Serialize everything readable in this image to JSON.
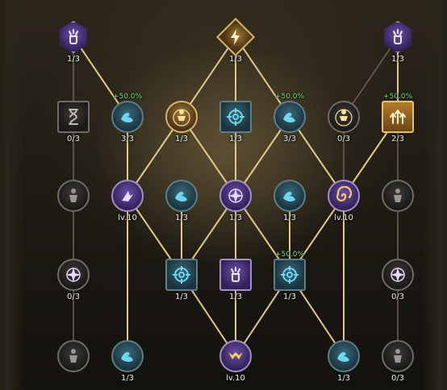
{
  "colors": {
    "line_active": "#e0c98a",
    "line_inactive": "#6a655a",
    "bonus_text": "#7de07a",
    "level_text": "#eeeeee"
  },
  "nodes": [
    {
      "id": "n1",
      "col": 0,
      "row": 0,
      "shape": "hex",
      "color": "purple",
      "icon": "fist-aura-icon",
      "level": "1/3"
    },
    {
      "id": "n2",
      "col": 3,
      "row": 0,
      "shape": "diamond",
      "color": "gold",
      "icon": "lightning-rune-icon",
      "level": "1/3"
    },
    {
      "id": "n3",
      "col": 6,
      "row": 0,
      "shape": "hex",
      "color": "purple",
      "icon": "fist-aura-icon",
      "level": "1/3"
    },
    {
      "id": "n4",
      "col": 0,
      "row": 1,
      "shape": "square",
      "color": "gray",
      "icon": "hourglass-icon",
      "level": "0/3"
    },
    {
      "id": "n5",
      "col": 1,
      "row": 1,
      "shape": "circle",
      "color": "blue",
      "icon": "flexed-arm-icon",
      "level": "3/3",
      "bonus": "+50.0%"
    },
    {
      "id": "n6",
      "col": 2,
      "row": 1,
      "shape": "circle",
      "color": "gold",
      "icon": "body-target-icon",
      "level": "1/3"
    },
    {
      "id": "n7",
      "col": 3,
      "row": 1,
      "shape": "square",
      "color": "blue",
      "icon": "crosshair-icon",
      "level": "1/3"
    },
    {
      "id": "n8",
      "col": 4,
      "row": 1,
      "shape": "circle",
      "color": "blue",
      "icon": "flexed-arm-icon",
      "level": "3/3",
      "bonus": "+50.0%"
    },
    {
      "id": "n9",
      "col": 5,
      "row": 1,
      "shape": "circle",
      "color": "gray",
      "icon": "body-target-icon",
      "level": "0/3"
    },
    {
      "id": "n10",
      "col": 6,
      "row": 1,
      "shape": "square",
      "color": "goldbg",
      "icon": "triple-arrow-up-icon",
      "level": "2/3",
      "bonus": "+50.0%"
    },
    {
      "id": "n11",
      "col": 0,
      "row": 2,
      "shape": "circle",
      "color": "gray",
      "icon": "body-icon",
      "level": ""
    },
    {
      "id": "n12",
      "col": 1,
      "row": 2,
      "shape": "circle",
      "color": "purple",
      "icon": "dash-strike-icon",
      "level": "lv.10"
    },
    {
      "id": "n13",
      "col": 2,
      "row": 2,
      "shape": "circle",
      "color": "blue",
      "icon": "flexed-arm-icon",
      "level": "1/3"
    },
    {
      "id": "n14",
      "col": 3,
      "row": 2,
      "shape": "circle",
      "color": "purple",
      "icon": "compass-star-icon",
      "level": "1/3"
    },
    {
      "id": "n15",
      "col": 4,
      "row": 2,
      "shape": "circle",
      "color": "blue",
      "icon": "flexed-arm-icon",
      "level": "1/3"
    },
    {
      "id": "n16",
      "col": 5,
      "row": 2,
      "shape": "circle",
      "color": "purple",
      "icon": "swirl-icon",
      "level": "lv.10"
    },
    {
      "id": "n17",
      "col": 6,
      "row": 2,
      "shape": "circle",
      "color": "gray",
      "icon": "body-icon",
      "level": ""
    },
    {
      "id": "n18",
      "col": 0,
      "row": 3,
      "shape": "circle",
      "color": "gray",
      "icon": "compass-star-icon",
      "level": "0/3"
    },
    {
      "id": "n19",
      "col": 2,
      "row": 3,
      "shape": "square",
      "color": "blue",
      "icon": "crosshair-icon",
      "level": "1/3"
    },
    {
      "id": "n20",
      "col": 3,
      "row": 3,
      "shape": "square",
      "color": "purple",
      "icon": "fist-aura-icon",
      "level": "1/3"
    },
    {
      "id": "n21",
      "col": 4,
      "row": 3,
      "shape": "square",
      "color": "blue",
      "icon": "crosshair-icon",
      "level": "1/3",
      "bonus": "+50.0%"
    },
    {
      "id": "n22",
      "col": 6,
      "row": 3,
      "shape": "circle",
      "color": "gray",
      "icon": "compass-star-icon",
      "level": "0/3"
    },
    {
      "id": "n23",
      "col": 0,
      "row": 4,
      "shape": "circle",
      "color": "gray",
      "icon": "body-icon",
      "level": ""
    },
    {
      "id": "n24",
      "col": 1,
      "row": 4,
      "shape": "circle",
      "color": "blue",
      "icon": "flexed-arm-icon",
      "level": "1/3"
    },
    {
      "id": "n25",
      "col": 3,
      "row": 4,
      "shape": "circle",
      "color": "purple",
      "icon": "wing-crest-icon",
      "level": "lv.10"
    },
    {
      "id": "n26",
      "col": 5,
      "row": 4,
      "shape": "circle",
      "color": "blue",
      "icon": "flexed-arm-icon",
      "level": "1/3"
    },
    {
      "id": "n27",
      "col": 6,
      "row": 4,
      "shape": "circle",
      "color": "gray",
      "icon": "body-icon",
      "level": "0/3"
    }
  ],
  "edges": [
    [
      "n1",
      "n5",
      true
    ],
    [
      "n3",
      "n10",
      true
    ],
    [
      "n2",
      "n6",
      true
    ],
    [
      "n2",
      "n7",
      true
    ],
    [
      "n2",
      "n8",
      true
    ],
    [
      "n1",
      "n4",
      false
    ],
    [
      "n3",
      "n9",
      false
    ],
    [
      "n5",
      "n12",
      true
    ],
    [
      "n6",
      "n12",
      true
    ],
    [
      "n6",
      "n14",
      true
    ],
    [
      "n7",
      "n14",
      true
    ],
    [
      "n8",
      "n14",
      true
    ],
    [
      "n8",
      "n16",
      true
    ],
    [
      "n10",
      "n16",
      true
    ],
    [
      "n9",
      "n16",
      false
    ],
    [
      "n4",
      "n11",
      false
    ],
    [
      "n10",
      "n17",
      false
    ],
    [
      "n12",
      "n19",
      true
    ],
    [
      "n13",
      "n19",
      true
    ],
    [
      "n14",
      "n19",
      true
    ],
    [
      "n14",
      "n20",
      true
    ],
    [
      "n14",
      "n21",
      true
    ],
    [
      "n15",
      "n21",
      true
    ],
    [
      "n16",
      "n21",
      true
    ],
    [
      "n11",
      "n18",
      false
    ],
    [
      "n17",
      "n22",
      false
    ],
    [
      "n12",
      "n24",
      true
    ],
    [
      "n19",
      "n25",
      true
    ],
    [
      "n20",
      "n25",
      true
    ],
    [
      "n21",
      "n25",
      true
    ],
    [
      "n21",
      "n26",
      true
    ],
    [
      "n16",
      "n26",
      true
    ],
    [
      "n18",
      "n23",
      false
    ],
    [
      "n22",
      "n27",
      false
    ]
  ]
}
